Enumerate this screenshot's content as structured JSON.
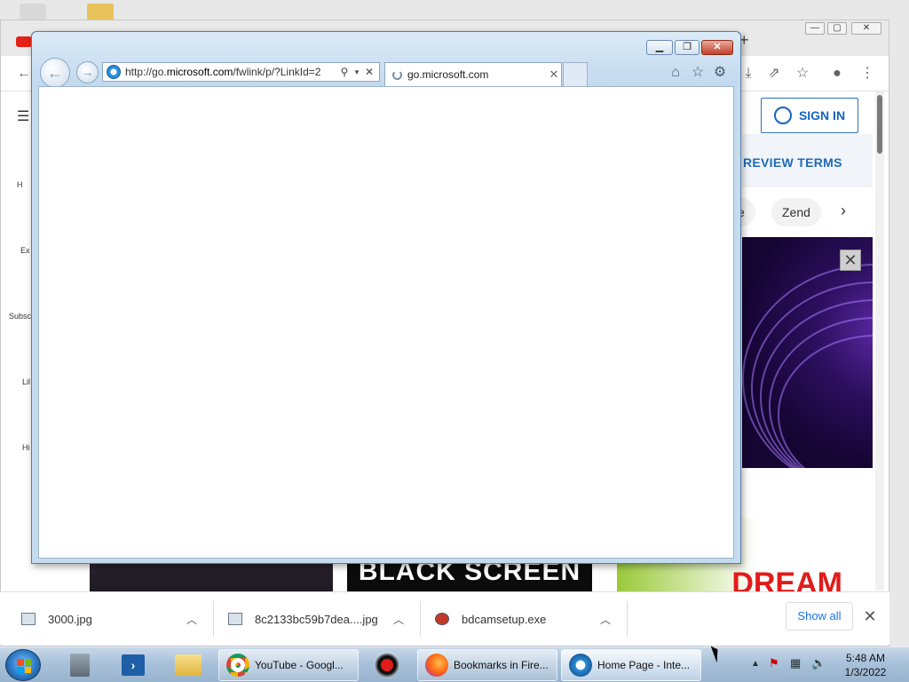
{
  "ie": {
    "address_url_prefix": "http://go.",
    "address_url_domain": "microsoft.com",
    "address_url_suffix": "/fwlink/p/?LinkId=2",
    "tab_title": "go.microsoft.com"
  },
  "chrome": {
    "signin_label": "SIGN IN",
    "review_terms_label": "REVIEW TERMS",
    "chips": [
      "e",
      "Zend"
    ],
    "sidebar_items": [
      "H",
      "Ex",
      "Subsc",
      "Lil",
      "Hi"
    ],
    "thumbnail_text": "BLACK SCREEN",
    "thumbnail_overlay": "DREAM"
  },
  "downloads": {
    "items": [
      {
        "name": "3000.jpg"
      },
      {
        "name": "8c2133bc59b7dea....jpg"
      },
      {
        "name": "bdcamsetup.exe"
      }
    ],
    "show_all_label": "Show all"
  },
  "taskbar": {
    "tasks": [
      {
        "label": "YouTube - Googl..."
      },
      {
        "label": "Bookmarks in Fire..."
      },
      {
        "label": "Home Page - Inte..."
      }
    ],
    "time": "5:48 AM",
    "date": "1/3/2022"
  },
  "colors": {
    "ie_frame": "#c5dcef",
    "chrome_accent": "#1565c0",
    "taskbar": "#a9c1da",
    "close_button": "#c2412c"
  },
  "icons": {
    "ie_back": "back-arrow-icon",
    "ie_forward": "forward-arrow-icon",
    "ie_home": "home-icon",
    "ie_favorites": "star-icon",
    "ie_tools": "gear-icon"
  }
}
